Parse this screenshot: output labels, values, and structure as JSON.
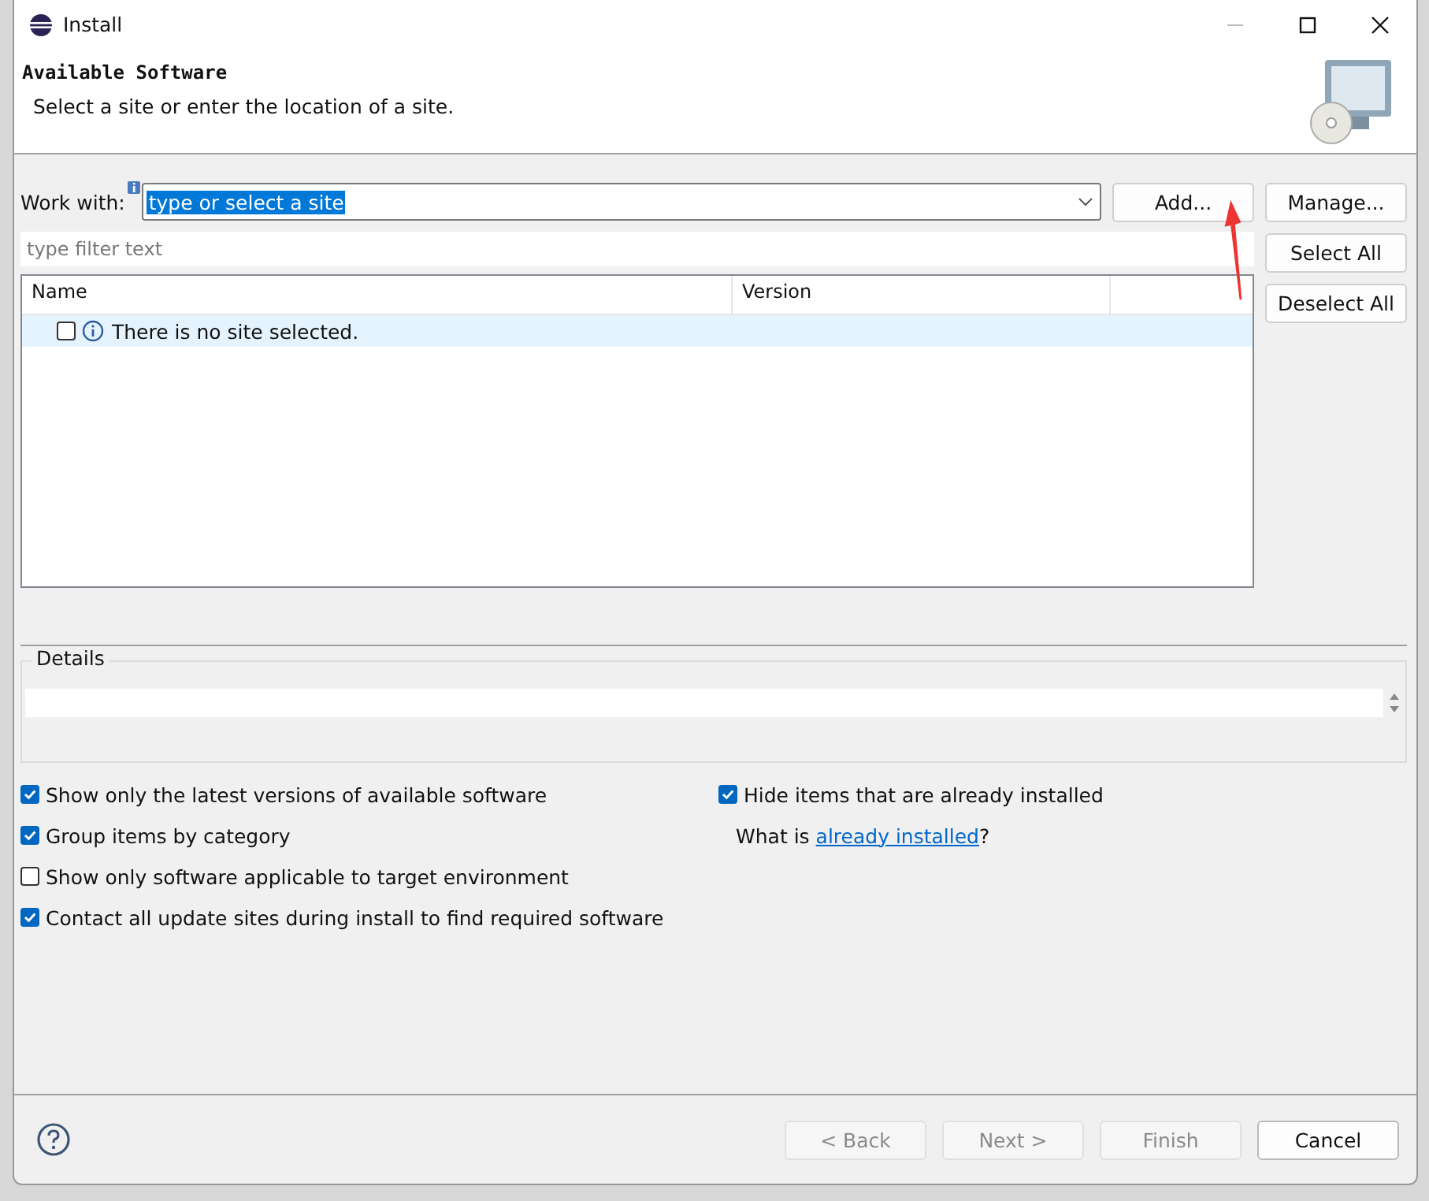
{
  "window": {
    "title": "Install"
  },
  "header": {
    "title": "Available Software",
    "subtitle": "Select a site or enter the location of a site."
  },
  "work_with": {
    "label": "Work with:",
    "value": "type or select a site"
  },
  "side_buttons": [
    {
      "label": "Add..."
    },
    {
      "label": "Manage..."
    }
  ],
  "filter": {
    "placeholder": "type filter text"
  },
  "list_buttons": [
    {
      "label": "Select All"
    },
    {
      "label": "Deselect All"
    }
  ],
  "table": {
    "columns": [
      "Name",
      "Version"
    ],
    "rows": [
      {
        "name": "There is no site selected.",
        "checked": false,
        "selected": true
      }
    ]
  },
  "details": {
    "label": "Details"
  },
  "options_left": [
    {
      "label": "Show only the latest versions of available software",
      "checked": true
    },
    {
      "label": "Group items by category",
      "checked": true
    },
    {
      "label": "Show only software applicable to target environment",
      "checked": false
    },
    {
      "label": "Contact all update sites during install to find required software",
      "checked": true
    }
  ],
  "options_right": {
    "label": "Hide items that are already installed",
    "checked": true,
    "prefix": "What is",
    "link": "already installed",
    "suffix": "?"
  },
  "footer_buttons": [
    {
      "label": "< Back",
      "disabled": true
    },
    {
      "label": "Next >",
      "disabled": true
    },
    {
      "label": "Finish",
      "disabled": true
    },
    {
      "label": "Cancel",
      "disabled": false
    }
  ]
}
